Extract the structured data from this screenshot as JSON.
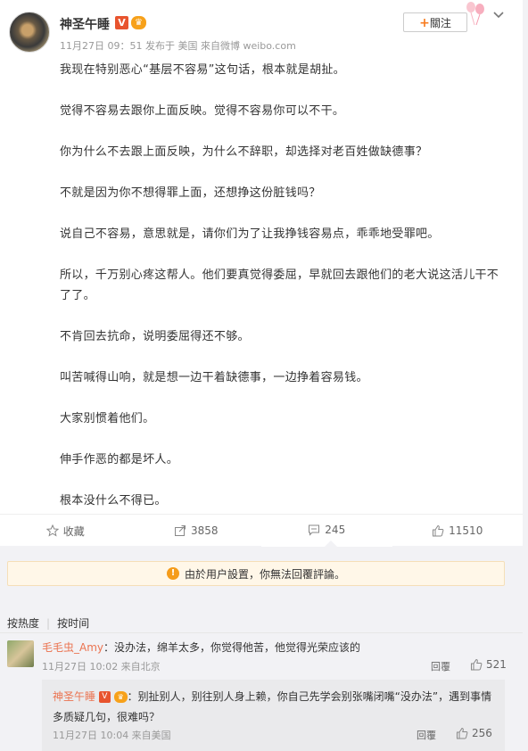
{
  "post": {
    "author": "神圣午睡",
    "meta": "11月27日 09：51 发布于 美国 來自微博 weibo.com",
    "follow_label": "關注",
    "paragraphs": [
      "我现在特别恶心“基层不容易”这句话，根本就是胡扯。",
      "觉得不容易去跟你上面反映。觉得不容易你可以不干。",
      "你为什么不去跟上面反映，为什么不辞职，却选择对老百姓做缺德事？",
      "不就是因为你不想得罪上面，还想挣这份脏钱吗？",
      "说自己不容易，意思就是，请你们为了让我挣钱容易点，乖乖地受罪吧。",
      "所以，千万别心疼这帮人。他们要真觉得委屈，早就回去跟他们的老大说这活儿干不了了。",
      "不肯回去抗命，说明委屈得还不够。",
      "叫苦喊得山响，就是想一边干着缺德事，一边挣着容易钱。",
      "大家别惯着他们。",
      "伸手作恶的都是坏人。",
      "根本没什么不得已。"
    ]
  },
  "actions": {
    "favorite": "收藏",
    "repost": "3858",
    "comment": "245",
    "like": "11510"
  },
  "notice": "由於用户設置，你無法回覆評論。",
  "sort": {
    "hot": "按热度",
    "time": "按时间"
  },
  "comment": {
    "user": "毛毛虫_Amy",
    "text": "：没办法，绵羊太多，你觉得他苦，他觉得光荣应该的",
    "meta": "11月27日 10:02 来自北京",
    "reply_label": "回覆",
    "likes": "521"
  },
  "reply": {
    "user": "神圣午睡",
    "text": "：别扯别人，别往别人身上赖，你自己先学会别张嘴闭嘴“没办法”，遇到事情多质疑几句，很难吗？",
    "meta": "11月27日 10:04 来自美国",
    "reply_label": "回覆",
    "likes": "256"
  },
  "colors": {
    "accent": "#eb7350",
    "vip": "#e8542e",
    "notice_bg": "#fff7e8"
  }
}
